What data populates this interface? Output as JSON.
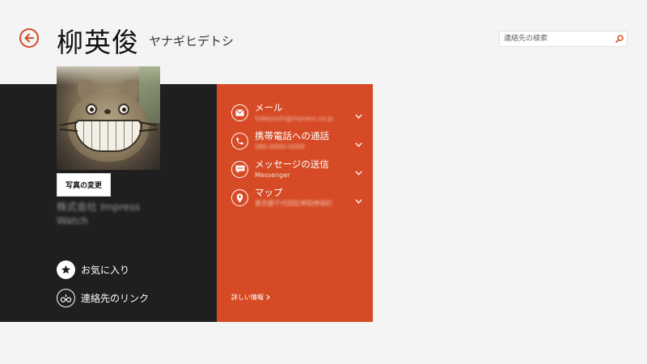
{
  "header": {
    "name": "柳英俊",
    "kana": "ヤナギヒデトシ"
  },
  "search": {
    "placeholder": "連絡先の検索",
    "value": ""
  },
  "profile": {
    "change_photo_label": "写真の変更",
    "company_line1": "株式会社 Impress",
    "company_line2": "Watch"
  },
  "actions": {
    "favorite_label": "お気に入り",
    "link_label": "連絡先のリンク"
  },
  "contact_items": [
    {
      "title": "メール",
      "subtitle": "hideyoshi@mpress.co.jp",
      "icon": "mail-icon"
    },
    {
      "title": "携帯電話への通話",
      "subtitle": "080-0000-0000",
      "icon": "phone-icon"
    },
    {
      "title": "メッセージの送信",
      "subtitle": "Messenger",
      "icon": "message-icon"
    },
    {
      "title": "マップ",
      "subtitle": "東京都千代田区神田神保町",
      "icon": "map-pin-icon"
    }
  ],
  "details_label": "詳しい情報",
  "colors": {
    "accent": "#d64b26",
    "dark_panel": "#1f1f1f",
    "background": "#f4f4f4"
  }
}
